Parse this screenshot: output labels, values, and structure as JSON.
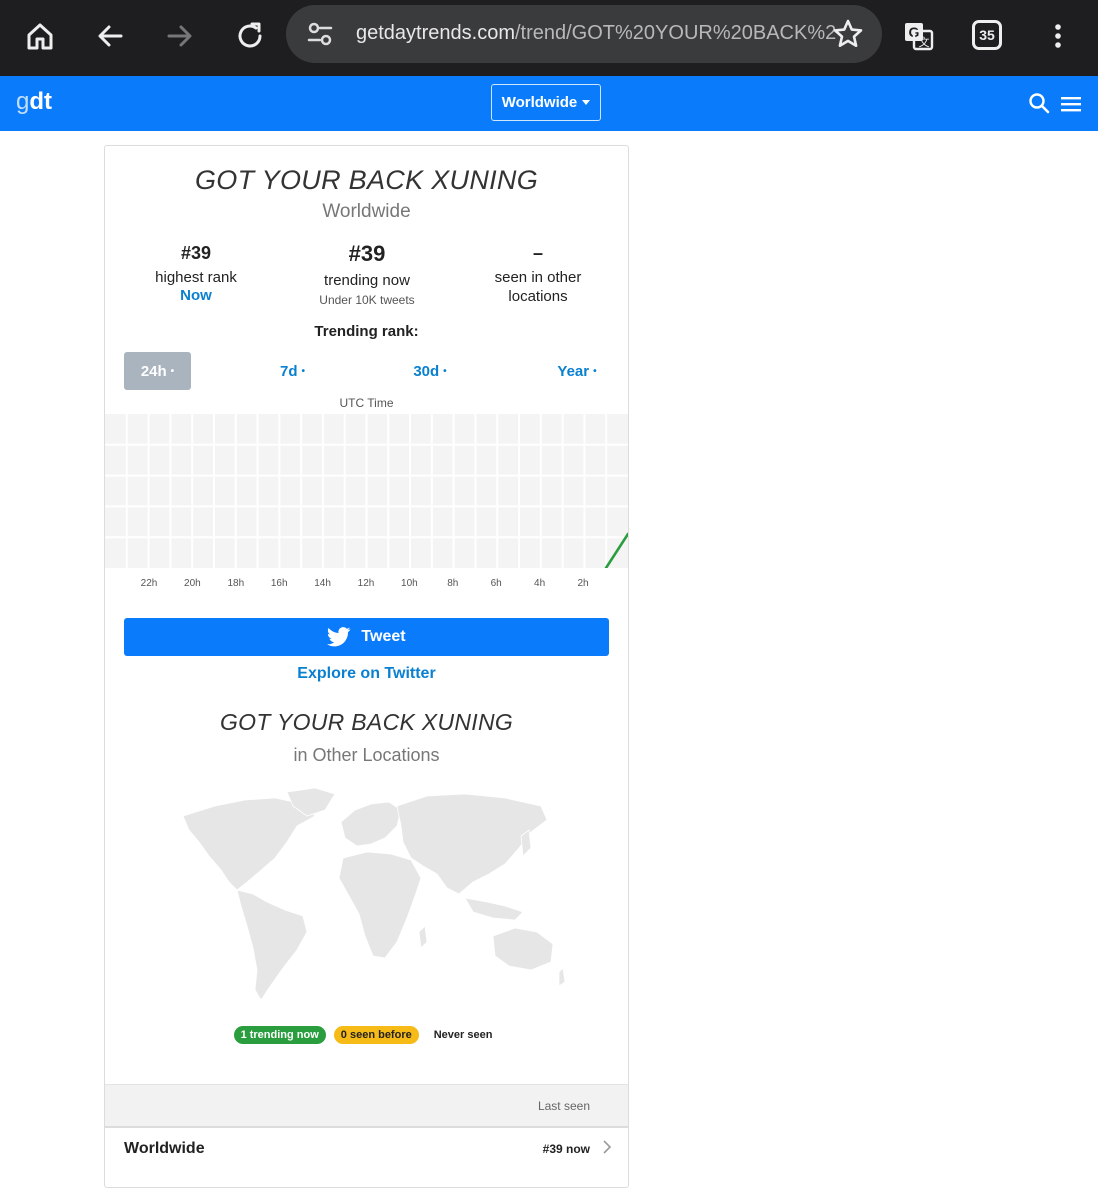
{
  "browser": {
    "url_host": "getdaytrends.com",
    "url_path": "/trend/GOT%20YOUR%20BACK%2",
    "tab_count": "35"
  },
  "header": {
    "logo_g": "g",
    "logo_dt": "dt",
    "region": "Worldwide"
  },
  "trend": {
    "title": "GOT YOUR BACK XUNING",
    "subtitle": "Worldwide",
    "stats": {
      "highest_rank": {
        "value": "#39",
        "label": "highest rank",
        "link": "Now"
      },
      "trending_now": {
        "value": "#39",
        "label": "trending now",
        "note": "Under 10K tweets"
      },
      "other_locations": {
        "value": "–",
        "label": "seen in other locations"
      }
    },
    "rank_label": "Trending rank:",
    "tabs": [
      {
        "label": "24h",
        "dot": "•",
        "active": true
      },
      {
        "label": "7d",
        "dot": "•",
        "active": false
      },
      {
        "label": "30d",
        "dot": "•",
        "active": false
      },
      {
        "label": "Year",
        "dot": "•",
        "active": false
      }
    ],
    "time_label": "UTC Time",
    "x_ticks": [
      "22h",
      "20h",
      "18h",
      "16h",
      "14h",
      "12h",
      "10h",
      "8h",
      "6h",
      "4h",
      "2h"
    ],
    "line_color": "#2a9d3e"
  },
  "actions": {
    "tweet": "Tweet",
    "explore": "Explore on Twitter"
  },
  "locations": {
    "title": "GOT YOUR BACK XUNING",
    "subtitle": "in Other Locations",
    "legend": {
      "trending": "1 trending now",
      "seen": "0 seen before",
      "never": "Never seen"
    },
    "table_header": "Last seen",
    "rows": [
      {
        "location": "Worldwide",
        "rank": "#39 now"
      }
    ]
  },
  "colors": {
    "brand": "#0a7cfb",
    "link": "#0a80d0",
    "trending": "#2a9d3e",
    "seen": "#f6bb16"
  }
}
